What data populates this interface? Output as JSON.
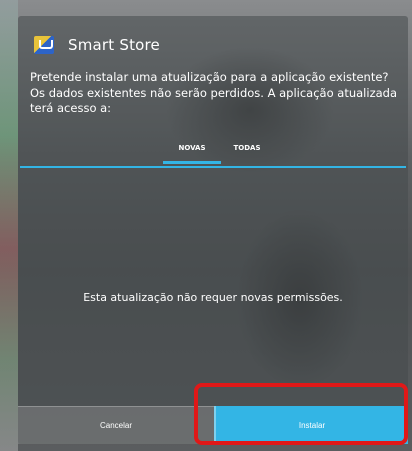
{
  "dialog": {
    "app_icon": "smart-store-icon",
    "title": "Smart Store",
    "message": "Pretende instalar uma atualização para a aplicação existente? Os dados existentes não serão perdidos. A aplicação atualizada terá acesso a:",
    "tabs": [
      {
        "label": "NOVAS",
        "selected": true
      },
      {
        "label": "TODAS",
        "selected": false
      }
    ],
    "no_permissions_text": "Esta atualização não requer novas permissões.",
    "buttons": {
      "cancel_label": "Cancelar",
      "install_label": "Instalar"
    }
  },
  "colors": {
    "accent": "#33b5e5",
    "highlight": "#e01818"
  }
}
